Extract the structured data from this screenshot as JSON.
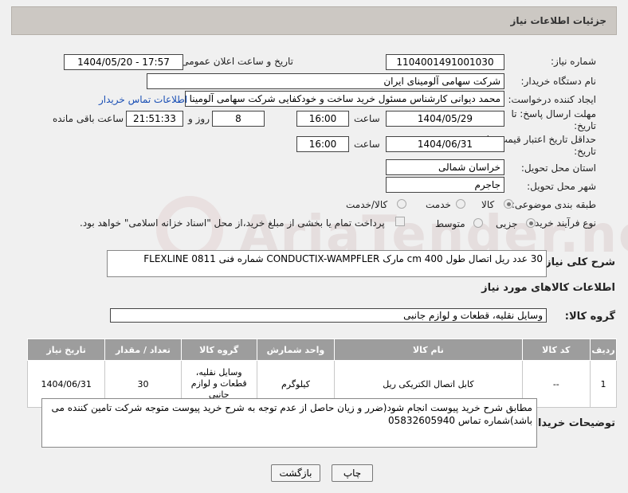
{
  "header": {
    "title": "جزئیات اطلاعات نیاز"
  },
  "fields": {
    "need_number_label": "شماره نیاز:",
    "need_number": "1104001491001030",
    "announce_label": "تاریخ و ساعت اعلان عمومی:",
    "announce_value": "1404/05/20 - 17:57",
    "buyer_org_label": "نام دستگاه خریدار:",
    "buyer_org": "شرکت سهامی آلومینای ایران",
    "creator_label": "ایجاد کننده درخواست:",
    "creator": "محمد دیوانی کارشناس مسئول خرید ساخت و خودکفایی شرکت سهامی آلومینا",
    "contact_link": "اطلاعات تماس خریدار",
    "deadline_label": "مهلت ارسال پاسخ: تا تاریخ:",
    "deadline_date": "1404/05/29",
    "time_label": "ساعت",
    "deadline_time": "16:00",
    "days_value": "8",
    "days_label": "روز و",
    "remaining_value": "21:51:33",
    "remaining_label": "ساعت باقی مانده",
    "validity_label": "حداقل تاریخ اعتبار قیمت: تا تاریخ:",
    "validity_date": "1404/06/31",
    "validity_time": "16:00",
    "province_label": "استان محل تحویل:",
    "province": "خراسان شمالی",
    "city_label": "شهر محل تحویل:",
    "city": "جاجرم",
    "category_label": "طبقه بندی موضوعی:",
    "category_options": [
      "کالا",
      "خدمت",
      "کالا/خدمت"
    ],
    "purchase_type_label": "نوع فرآیند خرید :",
    "purchase_options": [
      "جزیی",
      "متوسط"
    ],
    "payment_note": "پرداخت تمام یا بخشی از مبلغ خرید،از محل \"اسناد خزانه اسلامی\" خواهد بود.",
    "description_label": "شرح کلی نیاز:",
    "description": "30 عدد ریل اتصال طول 400 cm مارک CONDUCTIX-WAMPFLER شماره فنی FLEXLINE 0811"
  },
  "goods": {
    "section_title": "اطلاعات کالاهای مورد نیاز",
    "group_label": "گروه کالا:",
    "group_value": "وسایل نقلیه، قطعات و لوازم جانبی",
    "columns": [
      "ردیف",
      "کد کالا",
      "نام کالا",
      "واحد شمارش",
      "گروه کالا",
      "تعداد / مقدار",
      "تاریخ نیاز"
    ],
    "rows": [
      {
        "row": "1",
        "code": "--",
        "name": "کابل اتصال الکتریکی ریل",
        "unit": "کیلوگرم",
        "group": "وسایل نقلیه، قطعات و لوازم جانبی",
        "qty": "30",
        "date": "1404/06/31"
      }
    ]
  },
  "buyer_notes": {
    "label": "توضیحات خریدار:",
    "text": "مطابق شرح خرید پیوست انجام شود(ضرر و زیان حاصل از عدم توجه به شرح خرید پیوست متوجه شرکت تامین کننده می باشد)شماره تماس 05832605940"
  },
  "buttons": {
    "print": "چاپ",
    "back": "بازگشت"
  },
  "watermark": "AriaTender.neT"
}
